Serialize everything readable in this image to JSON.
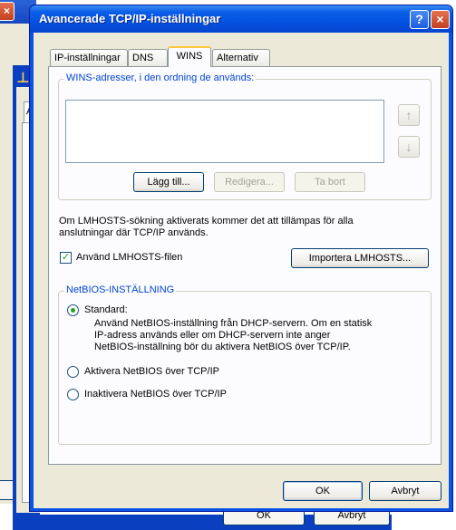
{
  "window": {
    "title": "Avancerade TCP/IP-inställningar",
    "help_glyph": "?",
    "close_glyph": "×"
  },
  "tabs": [
    {
      "label": "IP-inställningar",
      "active": false
    },
    {
      "label": "DNS",
      "active": false
    },
    {
      "label": "WINS",
      "active": true
    },
    {
      "label": "Alternativ",
      "active": false
    }
  ],
  "wins_group": {
    "label": "WINS-adresser, i den ordning de används:",
    "addresses": [],
    "up_glyph": "↑",
    "down_glyph": "↓",
    "add_label": "Lägg till...",
    "edit_label": "Redigera...",
    "remove_label": "Ta bort"
  },
  "lmhosts": {
    "info_line1": "Om LMHOSTS-sökning aktiverats kommer det att tillämpas för alla",
    "info_line2": "anslutningar där TCP/IP används.",
    "checkbox_label": "Använd LMHOSTS-filen",
    "checked": true,
    "import_label": "Importera LMHOSTS..."
  },
  "netbios": {
    "group_label": "NetBIOS-INSTÄLLNING",
    "options": [
      {
        "label": "Standard:",
        "selected": true
      },
      {
        "label": "Aktivera NetBIOS över TCP/IP",
        "selected": false
      },
      {
        "label": "Inaktivera NetBIOS över TCP/IP",
        "selected": false
      }
    ],
    "description_lines": [
      "Använd NetBIOS-inställning från DHCP-servern. Om en statisk",
      "IP-adress används eller om DHCP-servern inte anger",
      "NetBIOS-inställning bör du aktivera NetBIOS över TCP/IP."
    ]
  },
  "footer": {
    "ok_label": "OK",
    "cancel_label": "Avbryt"
  },
  "background": {
    "ok_label": "OK",
    "cancel_label": "Avbryt",
    "tab_fragment": "A"
  }
}
